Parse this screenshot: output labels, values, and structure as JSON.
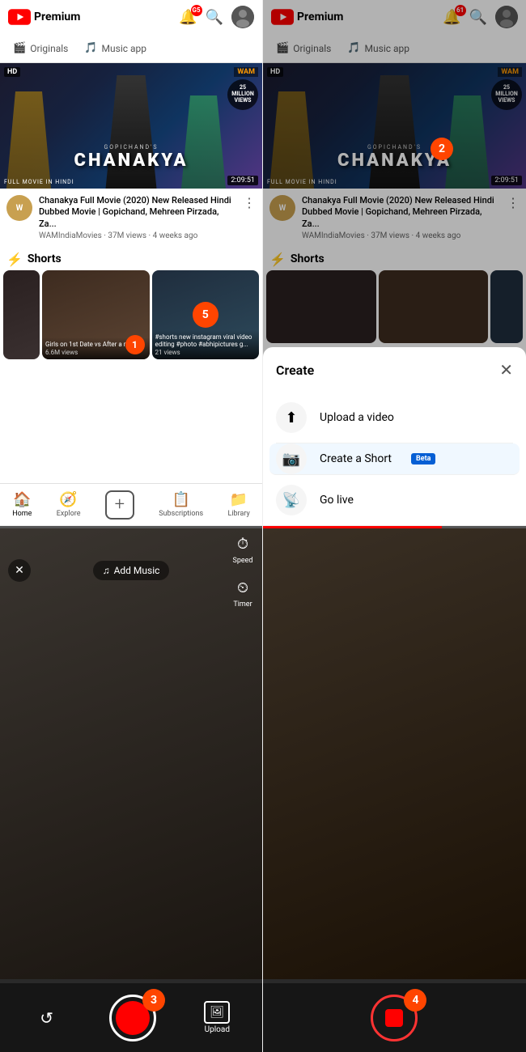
{
  "app": {
    "logo_text": "Premium",
    "notif_count_tl": "G5",
    "notif_count_tr": "61"
  },
  "nav": {
    "originals": "Originals",
    "music_app": "Music app"
  },
  "movie": {
    "hd_badge": "HD",
    "wam_badge": "WAM",
    "views_badge": "25 MILLION VIEWS",
    "gopichand": "GOPICHAND'S",
    "title": "CHANAKYA",
    "subtitle": "FULL MOVIE IN HINDI",
    "duration": "2:09:51"
  },
  "video_info": {
    "channel_abbr": "W",
    "title": "Chanakya Full Movie (2020) New Released Hindi Dubbed Movie | Gopichand, Mehreen Pirzada, Za...",
    "meta": "WAMIndiaMovies · 37M views · 4 weeks ago"
  },
  "shorts": {
    "section_label": "Shorts",
    "items": [
      {
        "caption": "",
        "views": ""
      },
      {
        "caption": "Girls on 1st Date vs After a month",
        "views": "6.6M views",
        "badge": "1"
      },
      {
        "caption": "#shorts new instagram viral video editing #photo #abhipictures g...",
        "views": "21 views",
        "badge": "5"
      }
    ]
  },
  "bottom_nav": {
    "items": [
      "Home",
      "Explore",
      "",
      "Subscriptions",
      "Library"
    ]
  },
  "create_modal": {
    "title": "Create",
    "close": "✕",
    "options": [
      {
        "icon": "⬆",
        "label": "Upload a video"
      },
      {
        "icon": "📷",
        "label": "Create a Short",
        "badge": "Beta"
      },
      {
        "icon": "📡",
        "label": "Go live"
      }
    ]
  },
  "camera": {
    "add_music": "Add Music",
    "speed_label": "Speed",
    "timer_label": "Timer",
    "upload_label": "Upload",
    "close_icon": "✕",
    "rotate_icon": "↺",
    "progress_pct": 68
  },
  "steps": {
    "s1": "1",
    "s2": "2",
    "s3": "3",
    "s4": "4",
    "s5": "5"
  }
}
